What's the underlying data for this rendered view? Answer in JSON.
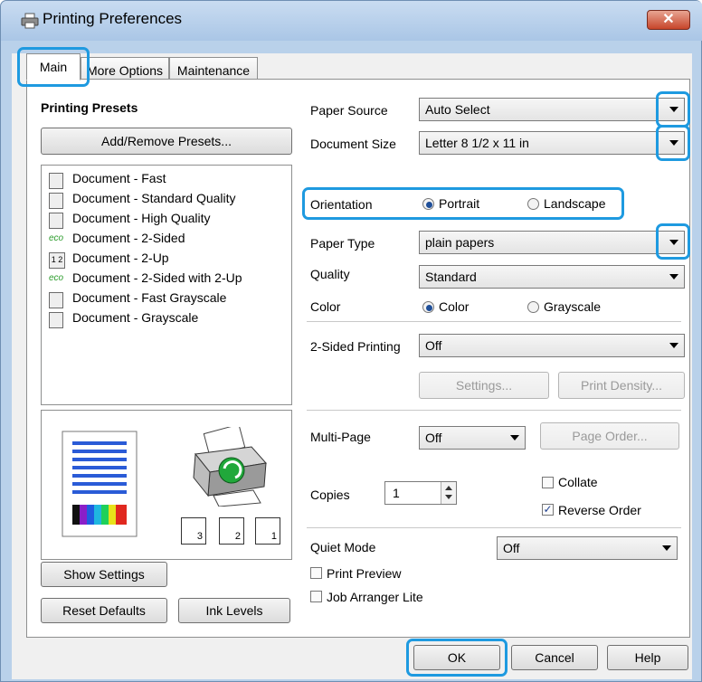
{
  "window": {
    "title": "Printing Preferences",
    "close_glyph": "✕"
  },
  "tabs": [
    {
      "label": "Main"
    },
    {
      "label": "More Options"
    },
    {
      "label": "Maintenance"
    }
  ],
  "presets": {
    "heading": "Printing Presets",
    "add_remove_button": "Add/Remove Presets...",
    "items": [
      {
        "label": "Document - Fast",
        "icon": "document-icon"
      },
      {
        "label": "Document - Standard Quality",
        "icon": "document-icon"
      },
      {
        "label": "Document - High Quality",
        "icon": "document-icon"
      },
      {
        "label": "Document - 2-Sided",
        "icon": "eco-icon"
      },
      {
        "label": "Document - 2-Up",
        "icon": "two-up-icon"
      },
      {
        "label": "Document - 2-Sided with 2-Up",
        "icon": "eco-icon"
      },
      {
        "label": "Document - Fast Grayscale",
        "icon": "document-icon"
      },
      {
        "label": "Document - Grayscale",
        "icon": "document-icon"
      }
    ],
    "eco_text": "eco",
    "two_up_text": "1 2"
  },
  "preview": {
    "page_labels": [
      "3",
      "2",
      "1"
    ]
  },
  "buttons": {
    "show_settings": "Show Settings",
    "reset_defaults": "Reset Defaults",
    "ink_levels": "Ink Levels",
    "ok": "OK",
    "cancel": "Cancel",
    "help": "Help",
    "settings": "Settings...",
    "print_density": "Print Density...",
    "page_order": "Page Order..."
  },
  "settings": {
    "paper_source": {
      "label": "Paper Source",
      "value": "Auto Select"
    },
    "document_size": {
      "label": "Document Size",
      "value": "Letter 8 1/2 x 11 in"
    },
    "orientation": {
      "label": "Orientation",
      "portrait": "Portrait",
      "landscape": "Landscape"
    },
    "paper_type": {
      "label": "Paper Type",
      "value": "plain papers"
    },
    "quality": {
      "label": "Quality",
      "value": "Standard"
    },
    "color": {
      "label": "Color",
      "color_option": "Color",
      "grayscale_option": "Grayscale"
    },
    "two_sided": {
      "label": "2-Sided Printing",
      "value": "Off"
    },
    "multi_page": {
      "label": "Multi-Page",
      "value": "Off"
    },
    "copies": {
      "label": "Copies",
      "value": "1"
    },
    "collate": {
      "label": "Collate",
      "checked": false
    },
    "reverse_order": {
      "label": "Reverse Order",
      "checked": true,
      "check_glyph": "✓"
    },
    "quiet_mode": {
      "label": "Quiet Mode",
      "value": "Off"
    },
    "print_preview": {
      "label": "Print Preview",
      "checked": false
    },
    "job_arranger": {
      "label": "Job Arranger Lite",
      "checked": false
    }
  },
  "colors": {
    "highlight": "#1e9ae0",
    "selected_radio": "#1f4f99",
    "eco_green": "#2c9c2c"
  }
}
